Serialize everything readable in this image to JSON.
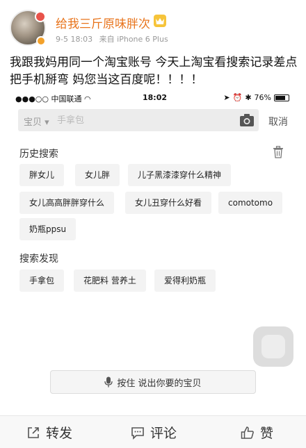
{
  "post": {
    "username": "给我三斤原味胖次",
    "date": "9-5 18:03",
    "source": "来自 iPhone 6 Plus",
    "text": "我跟我妈用同一个淘宝账号 今天上淘宝看搜索记录差点把手机掰弯 妈您当这百度呢！！！！",
    "colors": {
      "username": "#e8741c"
    }
  },
  "screenshot": {
    "status_bar": {
      "carrier": "中国联通",
      "time": "18:02",
      "battery": "76%",
      "battery_level": 0.76
    },
    "search": {
      "category": "宝贝",
      "placeholder": "手拿包",
      "cancel_label": "取消"
    },
    "history": {
      "title": "历史搜索",
      "items": [
        "胖女儿",
        "女儿胖",
        "儿子黑漆漆穿什么精神",
        "女儿高高胖胖穿什么",
        "女儿丑穿什么好看",
        "comotomo",
        "奶瓶ppsu"
      ]
    },
    "discover": {
      "title": "搜索发现",
      "items": [
        "手拿包",
        "花肥料 营养土",
        "爱得利奶瓶"
      ]
    },
    "voice": {
      "label": "按住  说出你要的宝贝"
    }
  },
  "actions": {
    "repost": "转发",
    "comment": "评论",
    "like": "赞"
  }
}
